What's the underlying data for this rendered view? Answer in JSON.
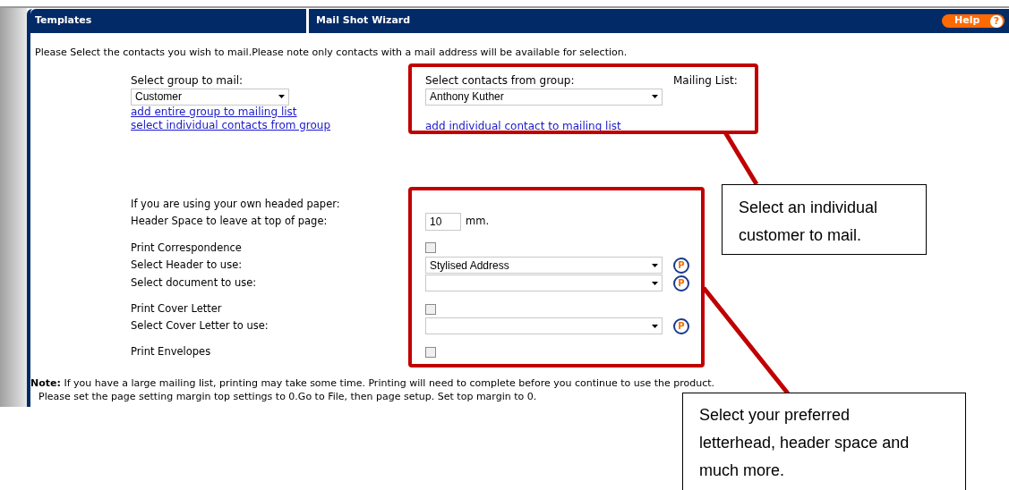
{
  "header": {
    "tabs": [
      {
        "label": "Templates"
      },
      {
        "label": "Mail Shot Wizard"
      }
    ],
    "help": {
      "label": "Help",
      "icon": "?"
    }
  },
  "intro": "Please Select the contacts you wish to mail.Please note only contacts with a mail address will be available for selection.",
  "group": {
    "label": "Select group to mail:",
    "value": "Customer",
    "links": [
      "add entire group to mailing list",
      "select individual contacts from group"
    ]
  },
  "contacts": {
    "label": "Select contacts from group:",
    "value": "Anthony Kuther",
    "link": "add individual contact to mailing list"
  },
  "mailing_list": {
    "label": "Mailing List:"
  },
  "print_options": [
    {
      "kind": "heading",
      "label": "If you are using your own headed paper:"
    },
    {
      "kind": "number",
      "label": "Header Space to leave at top of page:",
      "value": "10",
      "unit": "mm."
    },
    {
      "kind": "checkbox",
      "label": "Print Correspondence",
      "checked": false
    },
    {
      "kind": "select",
      "label": "Select Header to use:",
      "value": "Stylised Address",
      "button": "P"
    },
    {
      "kind": "select",
      "label": "Select document to use:",
      "button": "P"
    },
    {
      "kind": "checkbox",
      "label": "Print Cover Letter",
      "checked": false
    },
    {
      "kind": "select",
      "label": "Select Cover Letter to use:",
      "button": "P"
    },
    {
      "kind": "checkbox",
      "label": "Print Envelopes",
      "checked": false
    }
  ],
  "note": [
    "**Note:** If you have a large mailing list, printing may take some time. Printing will need to complete before you continue to use the product.",
    "Please set the page setting margin top settings to 0.Go to File, then page setup. Set top margin to 0."
  ],
  "callouts": [
    "Select an individual customer to mail.",
    "Select your preferred letterhead, header space and much more."
  ]
}
